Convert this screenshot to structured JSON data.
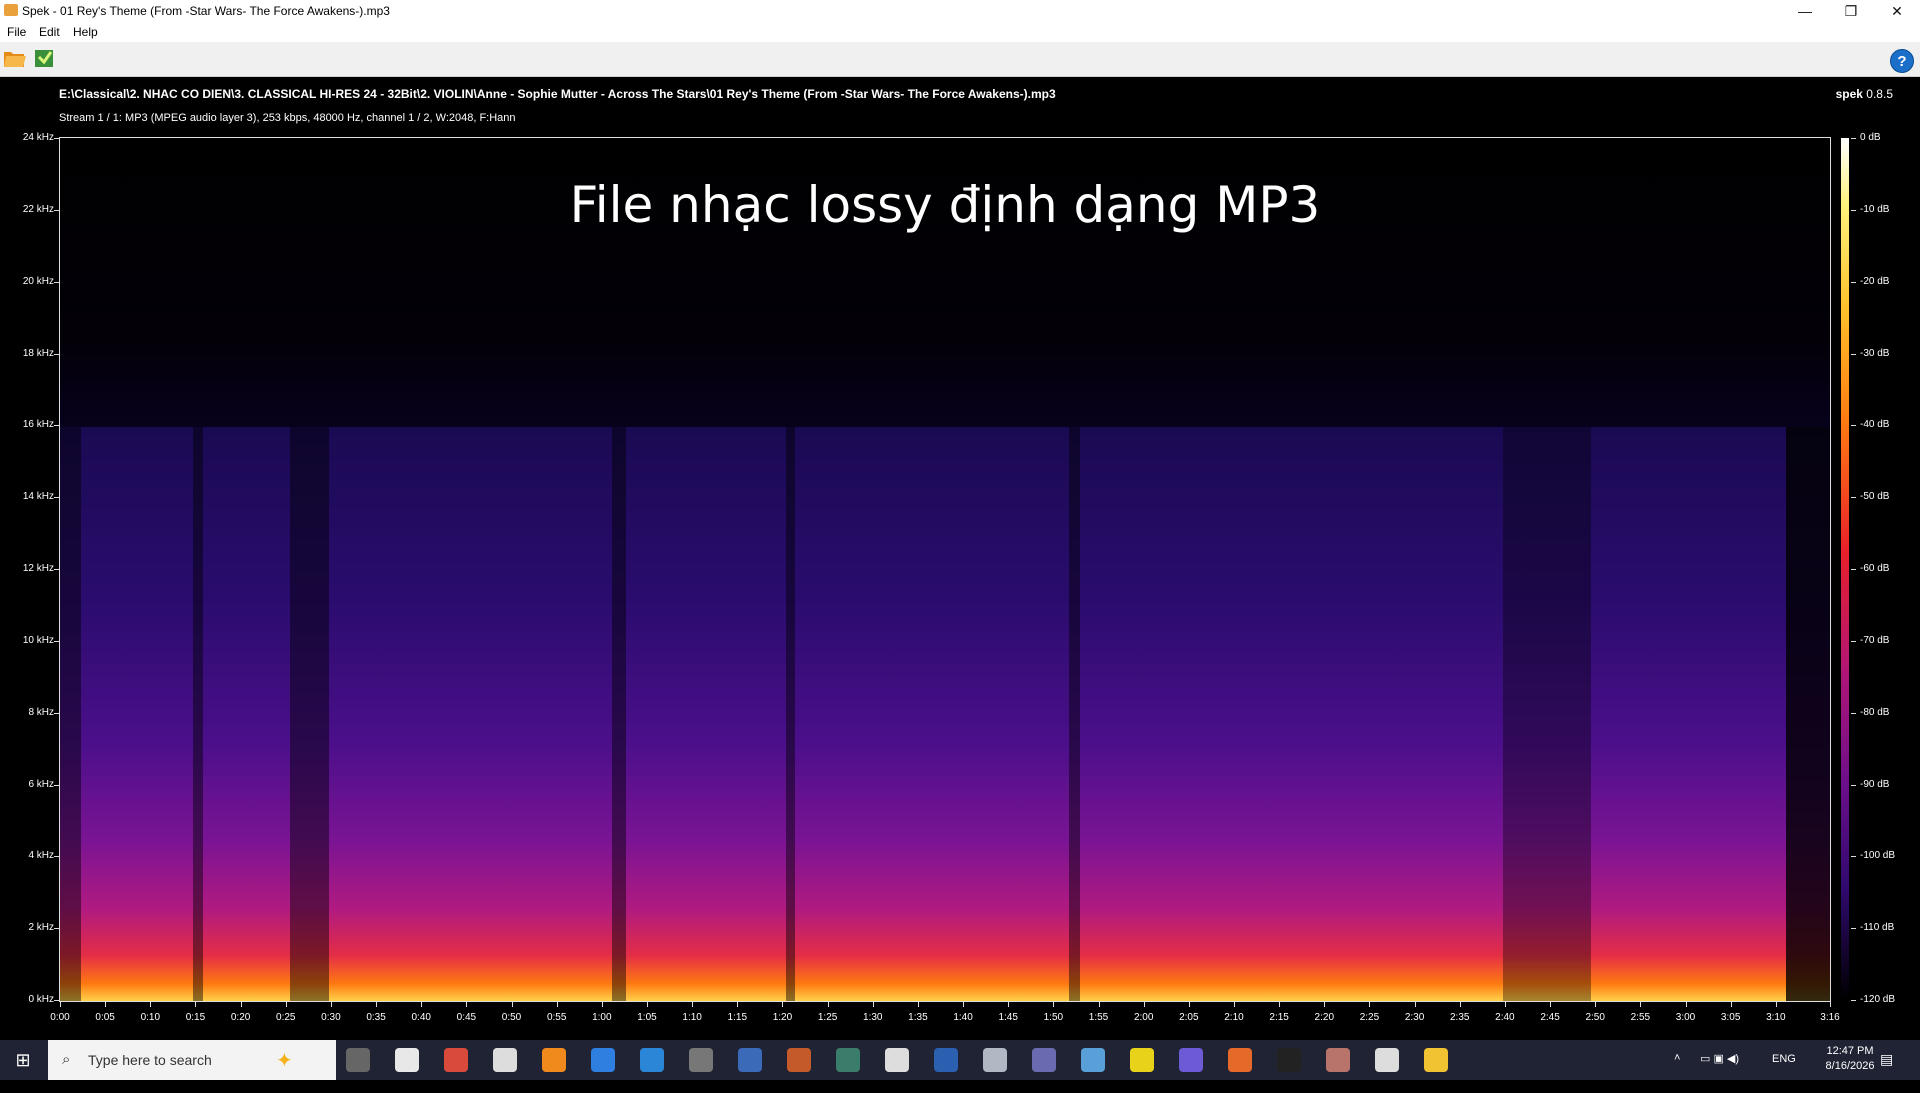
{
  "window": {
    "title": "Spek - 01 Rey's Theme (From -Star Wars- The Force Awakens-).mp3",
    "controls": {
      "minimize": "—",
      "restore": "❐",
      "close": "✕"
    }
  },
  "menu": {
    "items": [
      "File",
      "Edit",
      "Help"
    ]
  },
  "toolbar": {
    "open_icon": "folder-open-icon",
    "save_icon": "save-image-icon",
    "help_label": "?"
  },
  "spek": {
    "file_path": "E:\\Classical\\2. NHAC CO DIEN\\3. CLASSICAL HI-RES 24 - 32Bit\\2. VIOLIN\\Anne - Sophie Mutter - Across The Stars\\01 Rey's Theme (From -Star Wars- The Force Awakens-).mp3",
    "brand_name": "spek",
    "brand_version": "0.8.5",
    "stream_info": "Stream 1 / 1: MP3 (MPEG audio layer 3), 253 kbps, 48000 Hz, channel 1 / 2, W:2048, F:Hann",
    "overlay_text": "File nhạc lossy định dạng MP3"
  },
  "chart_data": {
    "type": "heatmap",
    "title": "",
    "y_axis": {
      "unit": "kHz",
      "range": [
        0,
        24
      ],
      "ticks": [
        "24 kHz",
        "22 kHz",
        "20 kHz",
        "18 kHz",
        "16 kHz",
        "14 kHz",
        "12 kHz",
        "10 kHz",
        "8 kHz",
        "6 kHz",
        "4 kHz",
        "2 kHz",
        "0 kHz"
      ]
    },
    "x_axis": {
      "range": [
        "0:00",
        "3:16"
      ],
      "ticks": [
        "0:00",
        "0:05",
        "0:10",
        "0:15",
        "0:20",
        "0:25",
        "0:30",
        "0:35",
        "0:40",
        "0:45",
        "0:50",
        "0:55",
        "1:00",
        "1:05",
        "1:10",
        "1:15",
        "1:20",
        "1:25",
        "1:30",
        "1:35",
        "1:40",
        "1:45",
        "1:50",
        "1:55",
        "2:00",
        "2:05",
        "2:10",
        "2:15",
        "2:20",
        "2:25",
        "2:30",
        "2:35",
        "2:40",
        "2:45",
        "2:50",
        "2:55",
        "3:00",
        "3:05",
        "3:10",
        "3:16"
      ]
    },
    "colorbar": {
      "unit": "dB",
      "range": [
        -120,
        0
      ],
      "ticks": [
        "0 dB",
        "-10 dB",
        "-20 dB",
        "-30 dB",
        "-40 dB",
        "-50 dB",
        "-60 dB",
        "-70 dB",
        "-80 dB",
        "-90 dB",
        "-100 dB",
        "-110 dB",
        "-120 dB"
      ]
    },
    "lowpass_cutoff_khz": 16
  },
  "taskbar": {
    "start_icon": "windows-start-icon",
    "search_placeholder": "Type here to search",
    "language": "ENG",
    "time": "12:47 PM",
    "date": "8/16/2026",
    "apps": [
      "task-view-icon",
      "chrome-icon",
      "app-icon",
      "app-icon",
      "vlc-icon",
      "zalo-icon",
      "app-icon",
      "eac-icon",
      "app-icon",
      "app-icon",
      "app-icon",
      "app-icon",
      "word-icon",
      "app-icon",
      "app-icon",
      "app-icon",
      "app-icon",
      "app-icon",
      "app-icon",
      "app-icon",
      "app-icon",
      "app-icon",
      "file-explorer-icon"
    ]
  }
}
